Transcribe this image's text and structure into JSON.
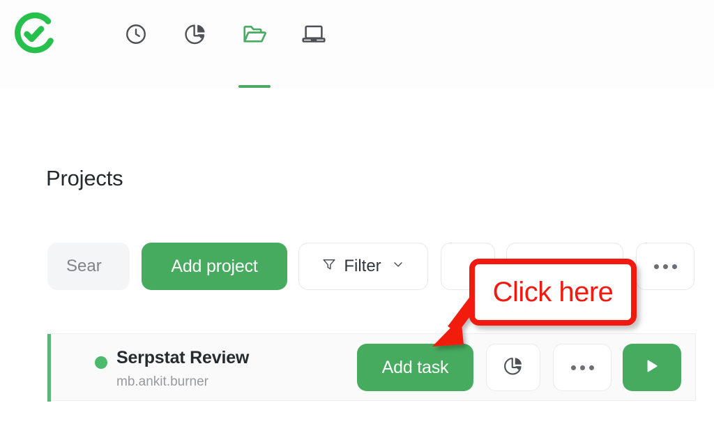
{
  "app": {
    "logo_icon": "checkmark-circle-logo",
    "accent_green": "#46ab5e",
    "annotation_red": "#f21a10",
    "background": "#ffffff"
  },
  "nav": {
    "items": [
      {
        "id": "timer",
        "icon": "clock-icon",
        "label": "Timer",
        "active": false
      },
      {
        "id": "reports",
        "icon": "pie-chart-icon",
        "label": "Reports",
        "active": false
      },
      {
        "id": "projects",
        "icon": "folder-open-icon",
        "label": "Projects",
        "active": true
      },
      {
        "id": "apps",
        "icon": "laptop-icon",
        "label": "Apps",
        "active": false
      }
    ]
  },
  "page": {
    "title": "Projects"
  },
  "toolbar": {
    "search": {
      "value": "",
      "placeholder": "Sear",
      "icon": "search-icon"
    },
    "add_project_label": "Add project",
    "filter": {
      "label": "Filter",
      "icon": "funnel-icon",
      "chevron": "chevron-down-icon"
    },
    "extra_button_a_label": "",
    "extra_button_b_label": "",
    "more_button_label": "•••"
  },
  "projects": [
    {
      "status_color": "#4cb96d",
      "name": "Serpstat Review",
      "owner": "mb.ankit.burner",
      "actions": {
        "add_task_label": "Add task",
        "chart_icon": "pie-chart-icon",
        "more_icon": "ellipsis-icon",
        "play_icon": "play-icon"
      }
    }
  ],
  "annotation": {
    "callout_text": "Click here",
    "arrow": "arrow-down-left",
    "color": "#f21a10"
  }
}
